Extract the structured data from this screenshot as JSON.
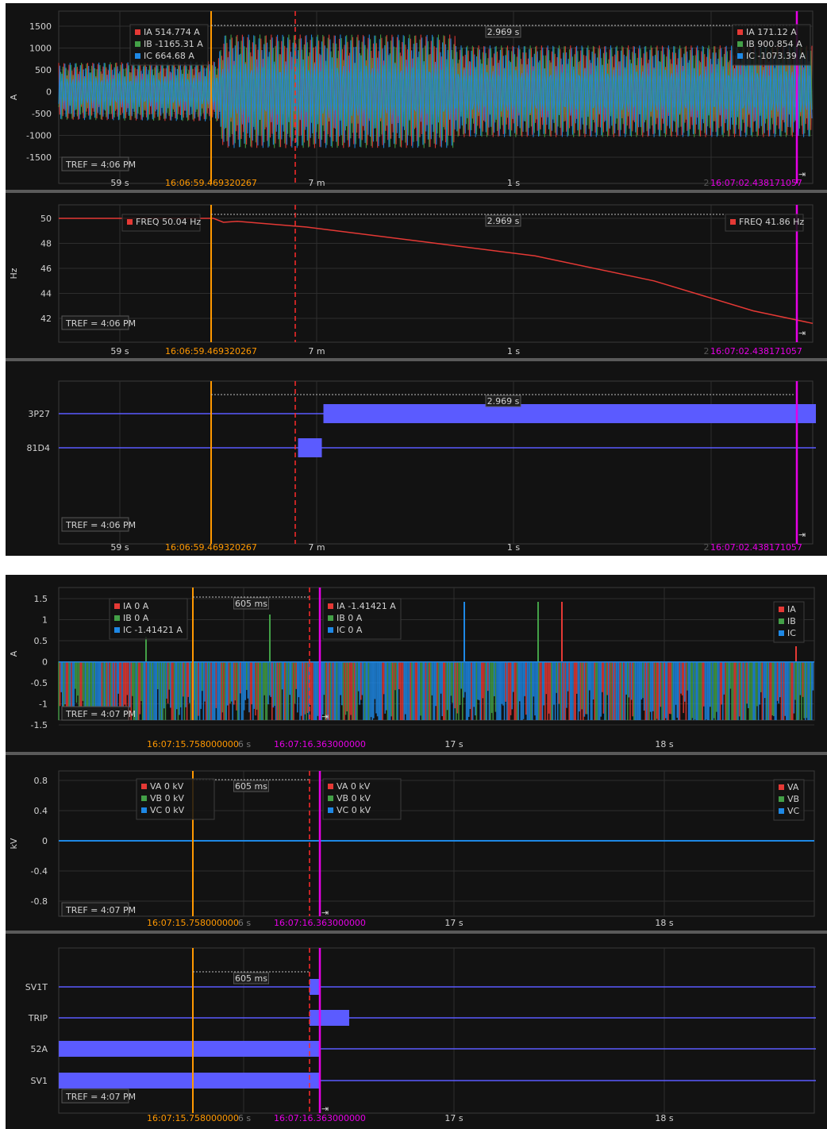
{
  "screen1": {
    "panels": [
      {
        "unit": "A",
        "yticks": [
          "1500",
          "1000",
          "500",
          "0",
          "-500",
          "-1000",
          "-1500"
        ],
        "legend_left": [
          {
            "label": "IA",
            "value": "514.774 A",
            "color": "#e53935"
          },
          {
            "label": "IB",
            "value": "-1165.31 A",
            "color": "#43a047"
          },
          {
            "label": "IC",
            "value": "664.68 A",
            "color": "#1e88e5"
          }
        ],
        "legend_right": [
          {
            "label": "IA",
            "value": "171.12 A",
            "color": "#e53935"
          },
          {
            "label": "IB",
            "value": "900.854 A",
            "color": "#43a047"
          },
          {
            "label": "IC",
            "value": "-1073.39 A",
            "color": "#1e88e5"
          }
        ],
        "delta": "2.969 s",
        "tref": "4:06 PM",
        "xlabels": {
          "a": "59 s",
          "cursor1": "16:06:59.469320267",
          "b": "7 m",
          "c": "1 s",
          "d": "2",
          "cursor2": "16:07:02.438171057"
        }
      },
      {
        "unit": "Hz",
        "yticks": [
          "50",
          "48",
          "46",
          "44",
          "42"
        ],
        "legend_left": [
          {
            "label": "FREQ",
            "value": "50.04 Hz",
            "color": "#e53935"
          }
        ],
        "legend_right": [
          {
            "label": "FREQ",
            "value": "41.86 Hz",
            "color": "#e53935"
          }
        ],
        "delta": "2.969 s",
        "tref": "4:06 PM",
        "xlabels": {
          "a": "59 s",
          "cursor1": "16:06:59.469320267",
          "b": "7 m",
          "c": "1 s",
          "d": "2",
          "cursor2": "16:07:02.438171057"
        }
      },
      {
        "unit": "",
        "digital_labels": [
          "3P27",
          "81D4"
        ],
        "delta": "2.969 s",
        "tref": "4:06 PM",
        "xlabels": {
          "a": "59 s",
          "cursor1": "16:06:59.469320267",
          "b": "7 m",
          "c": "1 s",
          "d": "2",
          "cursor2": "16:07:02.438171057"
        }
      }
    ]
  },
  "screen2": {
    "panels": [
      {
        "unit": "A",
        "yticks": [
          "1.5",
          "1",
          "0.5",
          "0",
          "-0.5",
          "-1",
          "-1.5"
        ],
        "legend_left": [
          {
            "label": "IA",
            "value": "0 A",
            "color": "#e53935"
          },
          {
            "label": "IB",
            "value": "0 A",
            "color": "#43a047"
          },
          {
            "label": "IC",
            "value": "-1.41421 A",
            "color": "#1e88e5"
          }
        ],
        "legend_mid": [
          {
            "label": "IA",
            "value": "-1.41421 A",
            "color": "#e53935"
          },
          {
            "label": "IB",
            "value": "0 A",
            "color": "#43a047"
          },
          {
            "label": "IC",
            "value": "0 A",
            "color": "#1e88e5"
          }
        ],
        "legend_right": [
          {
            "label": "IA",
            "color": "#e53935"
          },
          {
            "label": "IB",
            "color": "#43a047"
          },
          {
            "label": "IC",
            "color": "#1e88e5"
          }
        ],
        "delta": "605 ms",
        "tref": "4:07 PM",
        "xlabels": {
          "cursor1": "16:07:15.758000000",
          "a": "6 s",
          "cursor2": "16:07:16.363000000",
          "b": "17 s",
          "c": "18 s"
        }
      },
      {
        "unit": "kV",
        "yticks": [
          "0.8",
          "0.4",
          "0",
          "-0.4",
          "-0.8"
        ],
        "legend_left": [
          {
            "label": "VA",
            "value": "0 kV",
            "color": "#e53935"
          },
          {
            "label": "VB",
            "value": "0 kV",
            "color": "#43a047"
          },
          {
            "label": "VC",
            "value": "0 kV",
            "color": "#1e88e5"
          }
        ],
        "legend_mid": [
          {
            "label": "VA",
            "value": "0 kV",
            "color": "#e53935"
          },
          {
            "label": "VB",
            "value": "0 kV",
            "color": "#43a047"
          },
          {
            "label": "VC",
            "value": "0 kV",
            "color": "#1e88e5"
          }
        ],
        "legend_right": [
          {
            "label": "VA",
            "color": "#e53935"
          },
          {
            "label": "VB",
            "color": "#43a047"
          },
          {
            "label": "VC",
            "color": "#1e88e5"
          }
        ],
        "delta": "605 ms",
        "tref": "4:07 PM",
        "xlabels": {
          "cursor1": "16:07:15.758000000",
          "a": "6 s",
          "cursor2": "16:07:16.363000000",
          "b": "17 s",
          "c": "18 s"
        }
      },
      {
        "unit": "",
        "digital_labels": [
          "SV1T",
          "TRIP",
          "52A",
          "SV1"
        ],
        "delta": "605 ms",
        "tref": "4:07 PM",
        "xlabels": {
          "cursor1": "16:07:15.758000000",
          "a": "6 s",
          "cursor2": "16:07:16.363000000",
          "b": "17 s",
          "c": "18 s"
        }
      }
    ]
  },
  "colors": {
    "cursor1": "#ff9800",
    "cursor2": "#e600e6",
    "trigger": "#ff2a2a",
    "digital": "#5b5bff",
    "freq": "#e53935"
  },
  "chart_data": [
    {
      "type": "line",
      "title": "",
      "ylabel": "A",
      "ylim": [
        -1700,
        1600
      ],
      "x_range_s": [
        -0.8,
        3.0
      ],
      "cursors": {
        "cursor1": "16:06:59.469320267",
        "cursor2": "16:07:02.438171057",
        "delta": "2.969 s"
      },
      "series": [
        {
          "name": "IA",
          "values_at_cursor1": 514.774,
          "values_at_cursor2": 171.12
        },
        {
          "name": "IB",
          "values_at_cursor1": -1165.31,
          "values_at_cursor2": 900.854
        },
        {
          "name": "IC",
          "values_at_cursor1": 664.68,
          "values_at_cursor2": -1073.39
        }
      ],
      "envelope": {
        "t": [
          -0.8,
          0,
          0.03,
          1.2,
          1.2,
          3.0
        ],
        "peak": [
          650,
          690,
          1300,
          1300,
          1050,
          1050
        ]
      }
    },
    {
      "type": "line",
      "ylabel": "Hz",
      "ylim": [
        40.8,
        51
      ],
      "x_range_s": [
        -0.8,
        3.0
      ],
      "series": [
        {
          "name": "FREQ",
          "t": [
            -0.8,
            -0.02,
            0.03,
            0.1,
            0.45,
            1.0,
            1.6,
            2.2,
            2.7,
            3.0
          ],
          "values": [
            50.0,
            50.0,
            49.68,
            49.76,
            49.3,
            48.2,
            47.0,
            45.0,
            42.6,
            41.6
          ]
        }
      ]
    },
    {
      "type": "table",
      "ylabel": "",
      "x_range_s": [
        -0.8,
        3.0
      ],
      "series": [
        {
          "name": "3P27",
          "active_from_s": 0.55,
          "active_to_s": 3.0
        },
        {
          "name": "81D4",
          "active_from_s": 0.43,
          "active_to_s": 0.55
        }
      ]
    },
    {
      "type": "line",
      "ylabel": "A",
      "ylim": [
        -1.5,
        1.5
      ],
      "series": [
        {
          "name": "IA",
          "values_at_cursor1": 0,
          "values_at_cursor2": -1.41421
        },
        {
          "name": "IB",
          "values_at_cursor1": 0,
          "values_at_cursor2": 0
        },
        {
          "name": "IC",
          "values_at_cursor1": -1.41421,
          "values_at_cursor2": 0
        }
      ]
    },
    {
      "type": "line",
      "ylabel": "kV",
      "ylim": [
        -0.9,
        0.9
      ],
      "series": [
        {
          "name": "VA",
          "values": [
            0
          ]
        },
        {
          "name": "VB",
          "values": [
            0
          ]
        },
        {
          "name": "VC",
          "values": [
            0
          ]
        }
      ]
    },
    {
      "type": "table",
      "ylabel": "",
      "series": [
        {
          "name": "SV1T",
          "active_from_s": 0.551,
          "active_to_s": 0.605
        },
        {
          "name": "TRIP",
          "active_from_s": 0.551,
          "active_to_s": 0.745
        },
        {
          "name": "52A",
          "active_from_s": -0.65,
          "active_to_s": 0.605
        },
        {
          "name": "SV1",
          "active_from_s": -0.65,
          "active_to_s": 0.605
        }
      ]
    }
  ]
}
